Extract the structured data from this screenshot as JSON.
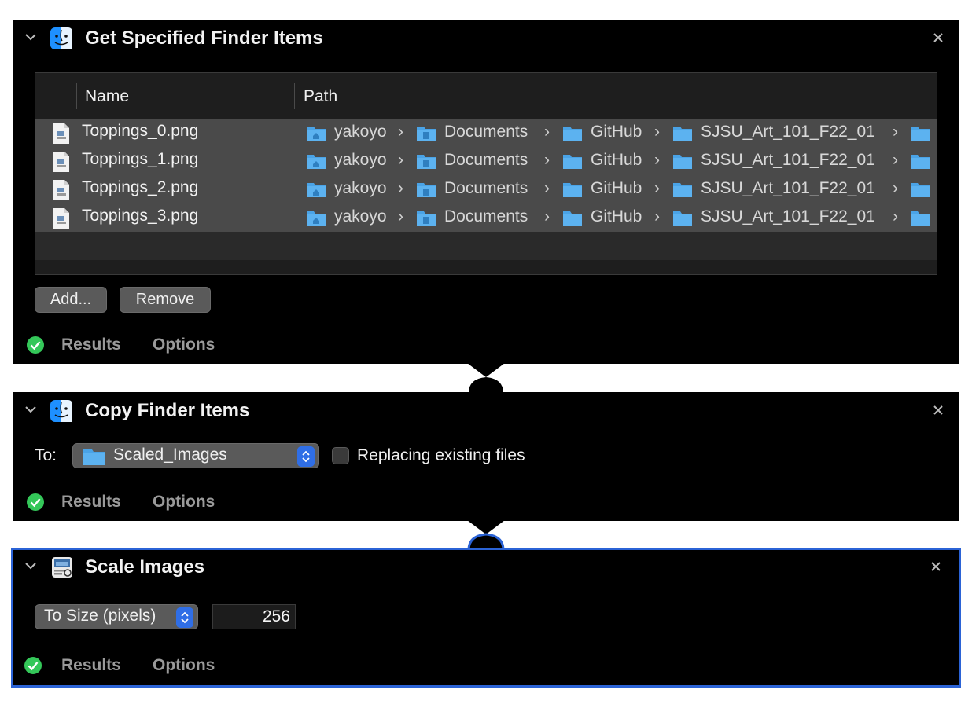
{
  "actions": [
    {
      "title": "Get Specified Finder Items",
      "table": {
        "columns": [
          "Name",
          "Path"
        ],
        "rows": [
          {
            "name": "Toppings_0.png",
            "path": [
              "yakoyo",
              "Documents",
              "GitHub",
              "SJSU_Art_101_F22_01"
            ]
          },
          {
            "name": "Toppings_1.png",
            "path": [
              "yakoyo",
              "Documents",
              "GitHub",
              "SJSU_Art_101_F22_01"
            ]
          },
          {
            "name": "Toppings_2.png",
            "path": [
              "yakoyo",
              "Documents",
              "GitHub",
              "SJSU_Art_101_F22_01"
            ]
          },
          {
            "name": "Toppings_3.png",
            "path": [
              "yakoyo",
              "Documents",
              "GitHub",
              "SJSU_Art_101_F22_01"
            ]
          }
        ]
      },
      "add_label": "Add...",
      "remove_label": "Remove",
      "results_label": "Results",
      "options_label": "Options"
    },
    {
      "title": "Copy Finder Items",
      "to_label": "To:",
      "destination": "Scaled_Images",
      "replacing_label": "Replacing existing files",
      "replacing_checked": false,
      "results_label": "Results",
      "options_label": "Options"
    },
    {
      "title": "Scale Images",
      "mode": "To Size (pixels)",
      "size_value": "256",
      "results_label": "Results",
      "options_label": "Options"
    }
  ],
  "colors": {
    "accent": "#2b63d6",
    "folder": "#4aa3e6",
    "check": "#34c759"
  },
  "icons": {
    "chevron": "chevron-down-icon",
    "close": "close-icon",
    "finder": "finder-icon",
    "preview": "preview-icon",
    "check": "checkmark-circle-icon",
    "folder": "folder-icon",
    "file": "png-file-icon"
  }
}
